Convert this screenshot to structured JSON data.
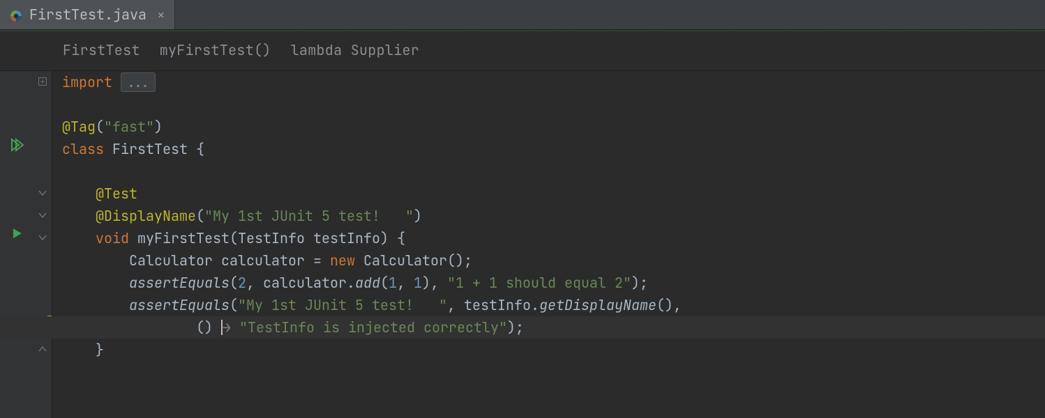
{
  "tab": {
    "filename": "FirstTest.java"
  },
  "breadcrumbs": {
    "a": "FirstTest",
    "b": "myFirstTest()",
    "c": "lambda Supplier"
  },
  "code": {
    "import_kw": "import",
    "import_fold": "...",
    "tag_ann": "@Tag",
    "tag_arg": "\"fast\"",
    "class_kw": "class ",
    "class_name": "FirstTest ",
    "brace_open": "{",
    "test_ann": "@Test",
    "dn_ann": "@DisplayName",
    "dn_arg": "\"My 1st JUnit 5 test!   \"",
    "void_kw": "void ",
    "method_name": "myFirstTest",
    "param_type": "TestInfo ",
    "param_name": "testInfo",
    "calc_type": "Calculator ",
    "calc_var": "calculator ",
    "eq": "= ",
    "new_kw": "new ",
    "calc_ctor": "Calculator",
    "semicolon_paren": "();",
    "assert1": "assertEquals",
    "two": "2",
    "comma": ", ",
    "calc_ref": "calculator.",
    "add": "add",
    "one_a": "1",
    "one_b": "1",
    "assert1_msg": "\"1 + 1 should equal 2\"",
    "assert2_arg1": "\"My 1st JUnit 5 test!   \"",
    "testinfo_ref": "testInfo.",
    "getdn": "getDisplayName",
    "lambda_params": "() ",
    "lambda_arrow": "→ ",
    "lambda_body": "\"TestInfo is injected correctly\"",
    "close_paren_semi": ");",
    "brace_close": "}"
  }
}
